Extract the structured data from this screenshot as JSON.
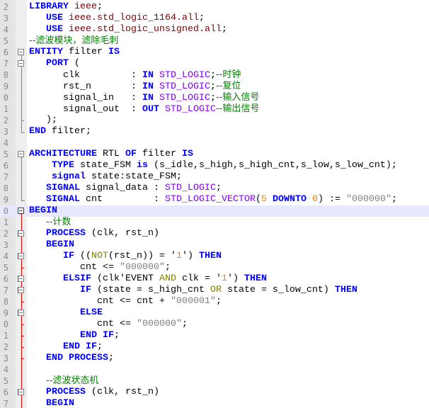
{
  "editor": {
    "highlight_color": "#e8e8ff",
    "colors": {
      "keyword": "#0000ff",
      "type": "#8000ff",
      "number": "#ff8000",
      "string": "#808080",
      "comment": "#008000",
      "operator": "#808000",
      "library": "#800000"
    },
    "lines": [
      {
        "n": "2",
        "fold": "",
        "t": [
          [
            "LIBRARY",
            "kw"
          ],
          [
            " ieee",
            "lib"
          ],
          [
            ";",
            "id"
          ]
        ]
      },
      {
        "n": "3",
        "fold": "",
        "t": [
          [
            "   ",
            "id"
          ],
          [
            "USE",
            "kw"
          ],
          [
            " ieee.std_logic_1164.all",
            "lib"
          ],
          [
            ";",
            "id"
          ]
        ]
      },
      {
        "n": "4",
        "fold": "",
        "t": [
          [
            "   ",
            "id"
          ],
          [
            "USE",
            "kw"
          ],
          [
            " ieee.std_logic_unsigned.all",
            "lib"
          ],
          [
            ";",
            "id"
          ]
        ]
      },
      {
        "n": "5",
        "fold": "",
        "t": [
          [
            "--滤波模块，滤除毛刺",
            "cm"
          ]
        ]
      },
      {
        "n": "6",
        "fold": "box",
        "t": [
          [
            "ENTITY",
            "kw"
          ],
          [
            " filter ",
            "id"
          ],
          [
            "IS",
            "kw"
          ]
        ]
      },
      {
        "n": "7",
        "fold": "box",
        "t": [
          [
            "   ",
            "id"
          ],
          [
            "PORT",
            "kw"
          ],
          [
            " (",
            "id"
          ]
        ]
      },
      {
        "n": "8",
        "fold": "line",
        "t": [
          [
            "      clk         : ",
            "id"
          ],
          [
            "IN",
            "kw"
          ],
          [
            " ",
            "id"
          ],
          [
            "STD_LOGIC",
            "ty"
          ],
          [
            ";",
            "id"
          ],
          [
            "--时钟",
            "cm"
          ]
        ]
      },
      {
        "n": "9",
        "fold": "line",
        "t": [
          [
            "      rst_n       : ",
            "id"
          ],
          [
            "IN",
            "kw"
          ],
          [
            " ",
            "id"
          ],
          [
            "STD_LOGIC",
            "ty"
          ],
          [
            ";",
            "id"
          ],
          [
            "--复位",
            "cm"
          ]
        ]
      },
      {
        "n": "0",
        "fold": "line",
        "t": [
          [
            "      signal_in   : ",
            "id"
          ],
          [
            "IN",
            "kw"
          ],
          [
            " ",
            "id"
          ],
          [
            "STD_LOGIC",
            "ty"
          ],
          [
            ";",
            "id"
          ],
          [
            "--输入信号",
            "cm"
          ]
        ]
      },
      {
        "n": "1",
        "fold": "line",
        "t": [
          [
            "      signal_out  : ",
            "id"
          ],
          [
            "OUT",
            "kw"
          ],
          [
            " ",
            "id"
          ],
          [
            "STD_LOGIC",
            "ty"
          ],
          [
            "--输出信号",
            "cm"
          ]
        ]
      },
      {
        "n": "2",
        "fold": "tick",
        "t": [
          [
            "   );",
            "id"
          ]
        ]
      },
      {
        "n": "3",
        "fold": "end",
        "t": [
          [
            "END",
            "kw"
          ],
          [
            " filter;",
            "id"
          ]
        ]
      },
      {
        "n": "4",
        "fold": "",
        "t": []
      },
      {
        "n": "5",
        "fold": "box",
        "t": [
          [
            "ARCHITECTURE",
            "kw"
          ],
          [
            " RTL ",
            "id"
          ],
          [
            "OF",
            "kw"
          ],
          [
            " filter ",
            "id"
          ],
          [
            "IS",
            "kw"
          ]
        ]
      },
      {
        "n": "6",
        "fold": "line",
        "t": [
          [
            "    ",
            "id"
          ],
          [
            "TYPE",
            "kw"
          ],
          [
            " state_FSM ",
            "id"
          ],
          [
            "is",
            "kw"
          ],
          [
            " (s_idle,s_high,s_high_cnt,s_low,s_low_cnt);",
            "id"
          ]
        ]
      },
      {
        "n": "7",
        "fold": "line",
        "t": [
          [
            "    ",
            "id"
          ],
          [
            "signal",
            "kw"
          ],
          [
            " state:state_FSM;",
            "id"
          ]
        ]
      },
      {
        "n": "8",
        "fold": "line",
        "t": [
          [
            "   ",
            "id"
          ],
          [
            "SIGNAL",
            "kw"
          ],
          [
            " signal_data : ",
            "id"
          ],
          [
            "STD_LOGIC",
            "ty"
          ],
          [
            ";",
            "id"
          ]
        ]
      },
      {
        "n": "9",
        "fold": "end",
        "t": [
          [
            "   ",
            "id"
          ],
          [
            "SIGNAL",
            "kw"
          ],
          [
            " cnt         : ",
            "id"
          ],
          [
            "STD_LOGIC_VECTOR",
            "ty"
          ],
          [
            "(",
            "id"
          ],
          [
            "5",
            "num"
          ],
          [
            " ",
            "id"
          ],
          [
            "DOWNTO",
            "kw"
          ],
          [
            " ",
            "id"
          ],
          [
            "0",
            "num"
          ],
          [
            ") := ",
            "id"
          ],
          [
            "\"000000\"",
            "str"
          ],
          [
            ";",
            "id"
          ]
        ]
      },
      {
        "n": "0",
        "fold": "rtop",
        "hl": true,
        "t": [
          [
            "BEGIN",
            "kw"
          ]
        ]
      },
      {
        "n": "1",
        "fold": "rline",
        "t": [
          [
            "   ",
            "id"
          ],
          [
            "--计数",
            "cm"
          ]
        ]
      },
      {
        "n": "2",
        "fold": "rbox",
        "t": [
          [
            "   ",
            "id"
          ],
          [
            "PROCESS",
            "kw"
          ],
          [
            " (clk, rst_n)",
            "id"
          ]
        ]
      },
      {
        "n": "3",
        "fold": "rline",
        "t": [
          [
            "   ",
            "id"
          ],
          [
            "BEGIN",
            "kw"
          ]
        ]
      },
      {
        "n": "4",
        "fold": "rbox",
        "t": [
          [
            "      ",
            "id"
          ],
          [
            "IF",
            "kw"
          ],
          [
            " ((",
            "id"
          ],
          [
            "NOT",
            "op"
          ],
          [
            "(rst_n)) = '",
            "id"
          ],
          [
            "1",
            "num"
          ],
          [
            "') ",
            "id"
          ],
          [
            "THEN",
            "kw"
          ]
        ]
      },
      {
        "n": "5",
        "fold": "rtick",
        "t": [
          [
            "         cnt <= ",
            "id"
          ],
          [
            "\"000000\"",
            "str"
          ],
          [
            ";",
            "id"
          ]
        ]
      },
      {
        "n": "6",
        "fold": "rbox",
        "t": [
          [
            "      ",
            "id"
          ],
          [
            "ELSIF",
            "kw"
          ],
          [
            " (clk'EVENT ",
            "id"
          ],
          [
            "AND",
            "op"
          ],
          [
            " clk = '",
            "id"
          ],
          [
            "1",
            "num"
          ],
          [
            "') ",
            "id"
          ],
          [
            "THEN",
            "kw"
          ]
        ]
      },
      {
        "n": "7",
        "fold": "rbox",
        "t": [
          [
            "         ",
            "id"
          ],
          [
            "IF",
            "kw"
          ],
          [
            " (state = s_high_cnt ",
            "id"
          ],
          [
            "OR",
            "op"
          ],
          [
            " state = s_low_cnt) ",
            "id"
          ],
          [
            "THEN",
            "kw"
          ]
        ]
      },
      {
        "n": "8",
        "fold": "rtick",
        "t": [
          [
            "            cnt <= cnt + ",
            "id"
          ],
          [
            "\"000001\"",
            "str"
          ],
          [
            ";",
            "id"
          ]
        ]
      },
      {
        "n": "9",
        "fold": "rbox",
        "t": [
          [
            "         ",
            "id"
          ],
          [
            "ELSE",
            "kw"
          ]
        ]
      },
      {
        "n": "0",
        "fold": "rtick",
        "t": [
          [
            "            cnt <= ",
            "id"
          ],
          [
            "\"000000\"",
            "str"
          ],
          [
            ";",
            "id"
          ]
        ]
      },
      {
        "n": "1",
        "fold": "rtick",
        "t": [
          [
            "         ",
            "id"
          ],
          [
            "END IF",
            "kw"
          ],
          [
            ";",
            "id"
          ]
        ]
      },
      {
        "n": "2",
        "fold": "rtick",
        "t": [
          [
            "      ",
            "id"
          ],
          [
            "END IF",
            "kw"
          ],
          [
            ";",
            "id"
          ]
        ]
      },
      {
        "n": "3",
        "fold": "rtick",
        "t": [
          [
            "   ",
            "id"
          ],
          [
            "END PROCESS",
            "kw"
          ],
          [
            ";",
            "id"
          ]
        ]
      },
      {
        "n": "4",
        "fold": "rline",
        "t": []
      },
      {
        "n": "5",
        "fold": "rline",
        "t": [
          [
            "   ",
            "id"
          ],
          [
            "--滤波状态机",
            "cm"
          ]
        ]
      },
      {
        "n": "6",
        "fold": "rbox",
        "t": [
          [
            "   ",
            "id"
          ],
          [
            "PROCESS",
            "kw"
          ],
          [
            " (clk, rst_n)",
            "id"
          ]
        ]
      },
      {
        "n": "7",
        "fold": "rline",
        "t": [
          [
            "   ",
            "id"
          ],
          [
            "BEGIN",
            "kw"
          ]
        ]
      }
    ]
  }
}
